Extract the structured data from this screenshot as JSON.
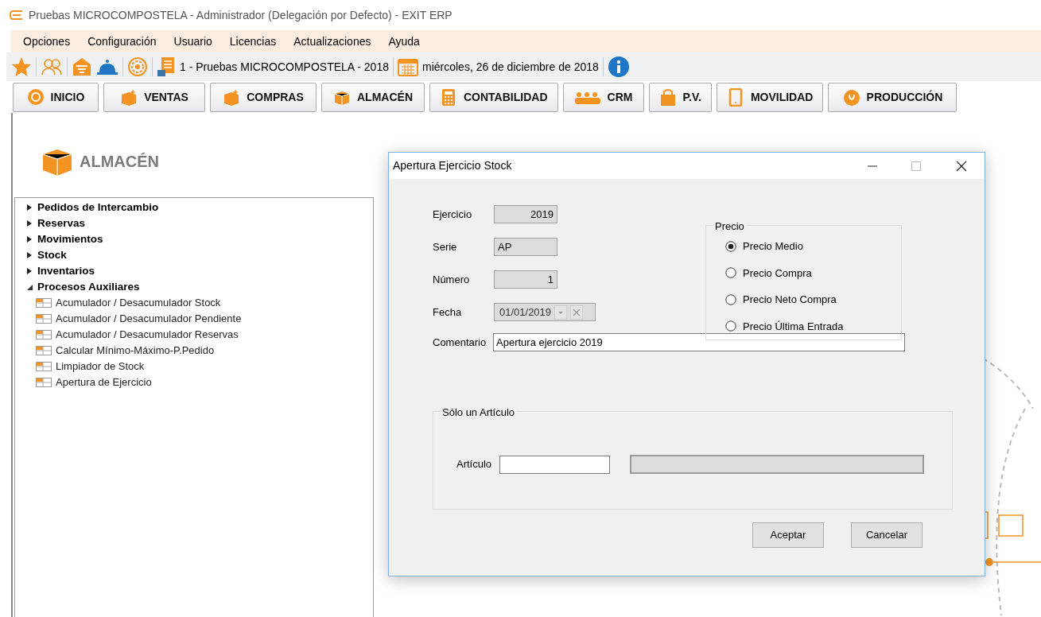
{
  "window": {
    "title": "Pruebas MICROCOMPOSTELA - Administrador (Delegación por Defecto) - EXIT ERP"
  },
  "menu": [
    "Opciones",
    "Configuración",
    "Usuario",
    "Licencias",
    "Actualizaciones",
    "Ayuda"
  ],
  "toolbar": {
    "company": "1 - Pruebas MICROCOMPOSTELA - 2018",
    "date": "miércoles, 26 de diciembre de 2018"
  },
  "modules": [
    {
      "label": "INICIO",
      "selected": false
    },
    {
      "label": "VENTAS",
      "selected": false
    },
    {
      "label": "COMPRAS",
      "selected": false
    },
    {
      "label": "ALMACÉN",
      "selected": false
    },
    {
      "label": "CONTABILIDAD",
      "selected": false
    },
    {
      "label": "CRM",
      "selected": false
    },
    {
      "label": "P.V.",
      "selected": false
    },
    {
      "label": "MOVILIDAD",
      "selected": false
    },
    {
      "label": "PRODUCCIÓN",
      "selected": false
    }
  ],
  "section_title": "ALMACÉN",
  "tree": [
    {
      "label": "Pedidos de Intercambio",
      "expanded": false
    },
    {
      "label": "Reservas",
      "expanded": false
    },
    {
      "label": "Movimientos",
      "expanded": false
    },
    {
      "label": "Stock",
      "expanded": false
    },
    {
      "label": "Inventarios",
      "expanded": false
    },
    {
      "label": "Procesos Auxiliares",
      "expanded": true,
      "children": [
        {
          "label": "Acumulador / Desacumulador Stock"
        },
        {
          "label": "Acumulador / Desacumulador Pendiente"
        },
        {
          "label": "Acumulador / Desacumulador Reservas"
        },
        {
          "label": "Calcular Mínimo-Máximo-P.Pedido"
        },
        {
          "label": "Limpiador de Stock"
        },
        {
          "label": "Apertura de Ejercicio"
        }
      ]
    }
  ],
  "dialog": {
    "title": "Apertura Ejercicio Stock",
    "fields": [
      {
        "label": "Ejercicio",
        "value": "2019",
        "kind": "number"
      },
      {
        "label": "Serie",
        "value": "AP",
        "kind": "text"
      },
      {
        "label": "Número",
        "value": "1",
        "kind": "number"
      },
      {
        "label": "Fecha",
        "value": "01/01/2019",
        "kind": "date"
      }
    ],
    "comment": {
      "label": "Comentario",
      "value": "Apertura ejercicio 2019"
    },
    "price": {
      "title": "Precio",
      "options": [
        {
          "label": "Precio Medio",
          "selected": true
        },
        {
          "label": "Precio Compra",
          "selected": false
        },
        {
          "label": "Precio Neto Compra",
          "selected": false
        },
        {
          "label": "Precio Última Entrada",
          "selected": false
        }
      ]
    },
    "article": {
      "title": "Sólo un Artículo",
      "label": "Artículo"
    },
    "buttons": [
      "Aceptar",
      "Cancelar"
    ]
  }
}
